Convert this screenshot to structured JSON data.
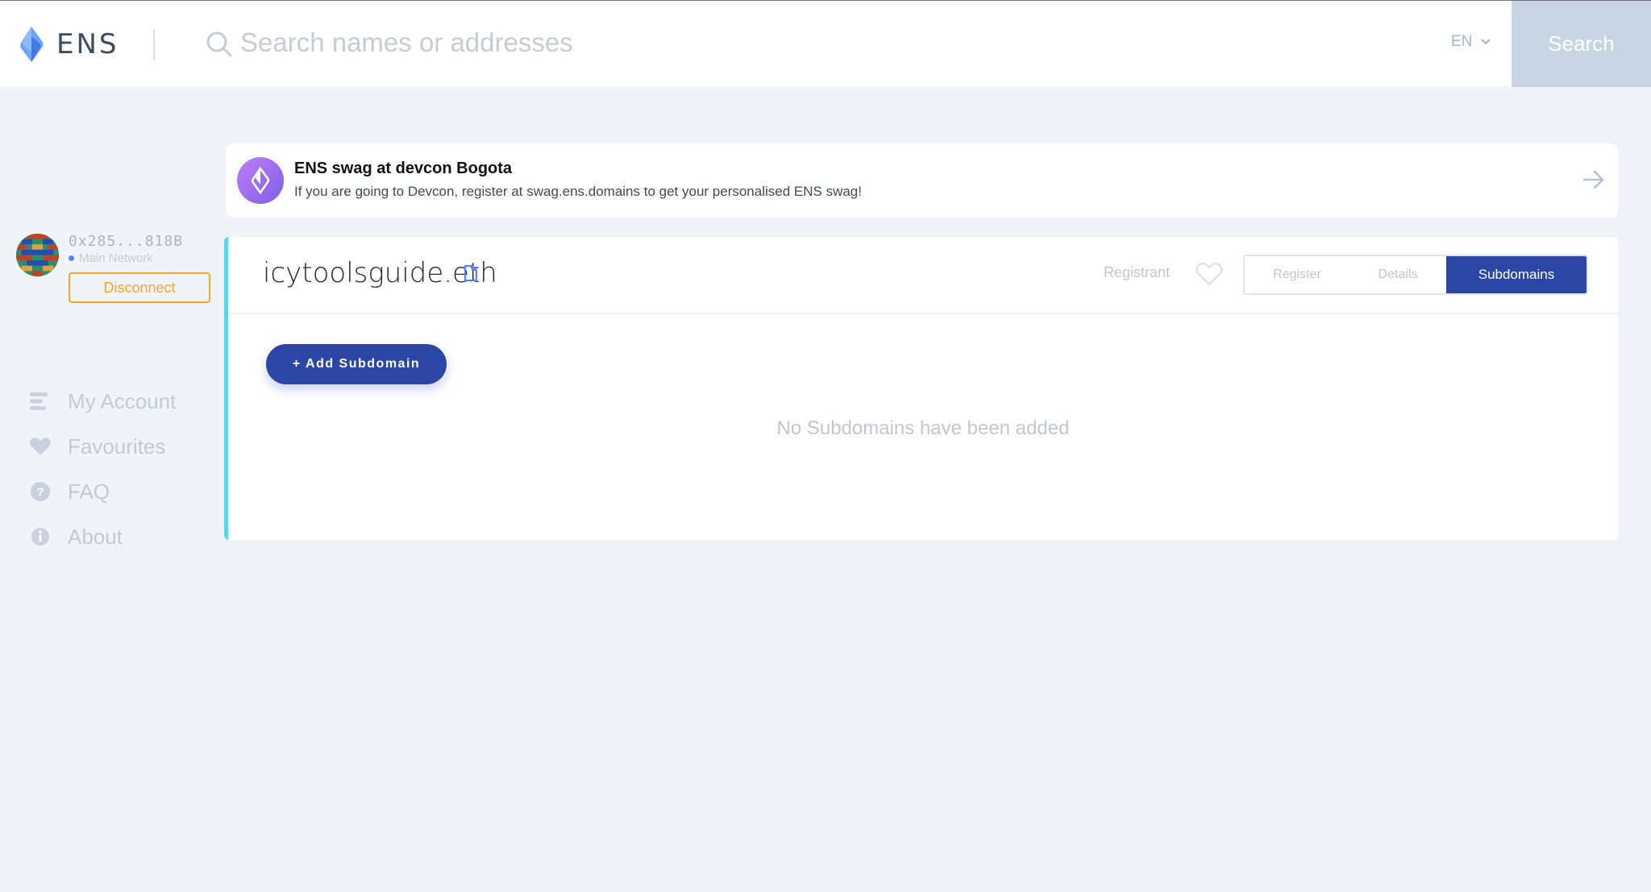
{
  "header": {
    "logo_text": "ENS",
    "search_placeholder": "Search names or addresses",
    "language": "EN",
    "search_button": "Search"
  },
  "account": {
    "address": "0x285...818B",
    "network": "Main Network",
    "disconnect_label": "Disconnect"
  },
  "sidebar": {
    "items": [
      {
        "label": "My Account",
        "icon": "account-icon"
      },
      {
        "label": "Favourites",
        "icon": "heart-icon"
      },
      {
        "label": "FAQ",
        "icon": "question-icon"
      },
      {
        "label": "About",
        "icon": "info-icon"
      }
    ]
  },
  "banner": {
    "title": "ENS swag at devcon Bogota",
    "text": "If you are going to Devcon, register at swag.ens.domains to get your personalised ENS swag!"
  },
  "domain": {
    "name": "icytoolsguide.eth",
    "registrant_label": "Registrant",
    "tabs": [
      "Register",
      "Details",
      "Subdomains"
    ],
    "active_tab": "Subdomains",
    "add_subdomain_label": "+ Add Subdomain",
    "empty_message": "No Subdomains have been added"
  },
  "colors": {
    "accent": "#2c46a6",
    "disconnect": "#f5a623",
    "card_border": "#5ad6e8"
  }
}
